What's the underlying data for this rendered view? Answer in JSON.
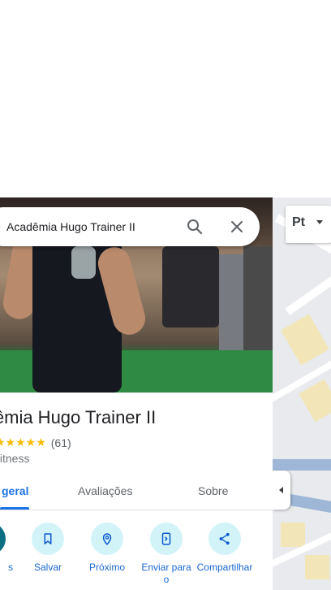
{
  "search": {
    "value": "Acadêmia Hugo Trainer II"
  },
  "place": {
    "title": "lêmia Hugo Trainer II",
    "stars": "★★★★★",
    "review_count": "(61)",
    "category": "fitness"
  },
  "tabs": [
    {
      "label": "geral",
      "active": true
    },
    {
      "label": "Avaliações",
      "active": false
    },
    {
      "label": "Sobre",
      "active": false
    }
  ],
  "actions": [
    {
      "label": "s",
      "icon": "directions-icon"
    },
    {
      "label": "Salvar",
      "icon": "bookmark-icon"
    },
    {
      "label": "Próximo",
      "icon": "nearby-icon"
    },
    {
      "label": "Enviar para o",
      "icon": "send-to-phone-icon"
    },
    {
      "label": "Compartilhar",
      "icon": "share-icon"
    }
  ],
  "map": {
    "layer_label": "Pt"
  },
  "colors": {
    "accent": "#1a73e8",
    "action_bg": "#d2f4f9",
    "star": "#fbbc04"
  }
}
